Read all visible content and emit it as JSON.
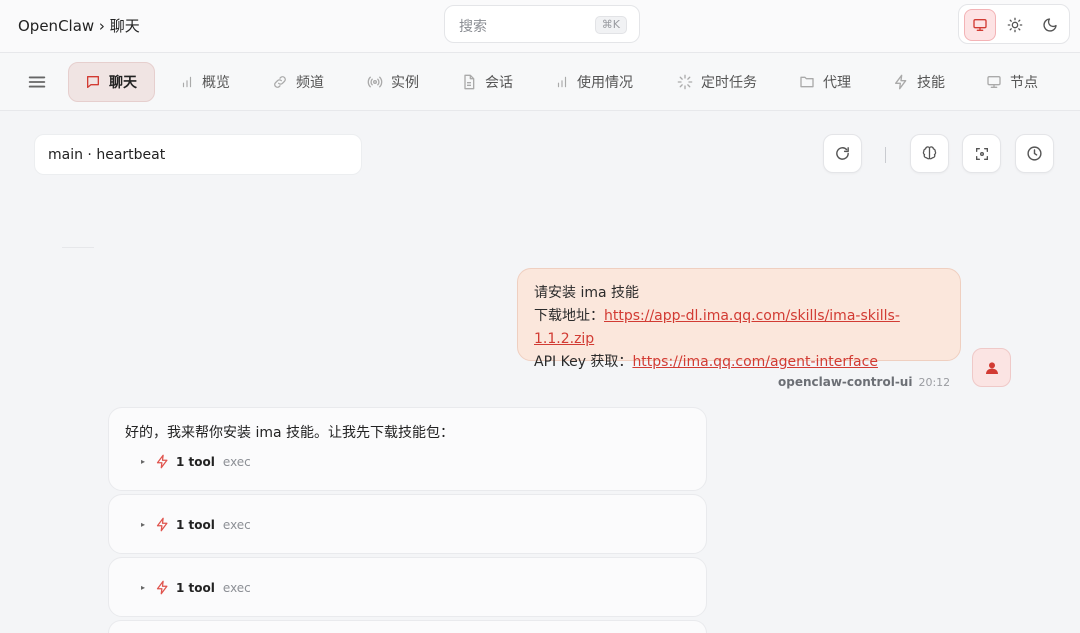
{
  "header": {
    "brand": "OpenClaw › 聊天",
    "search_placeholder": "搜索",
    "search_shortcut": "⌘K"
  },
  "theme": {
    "options": [
      "monitor-icon",
      "sun-icon",
      "moon-icon"
    ],
    "active": "monitor-icon"
  },
  "nav": {
    "tabs": [
      {
        "label": "聊天",
        "icon": "chat-icon",
        "active": true
      },
      {
        "label": "概览",
        "icon": "bar-chart-icon"
      },
      {
        "label": "频道",
        "icon": "link-icon"
      },
      {
        "label": "实例",
        "icon": "radio-icon"
      },
      {
        "label": "会话",
        "icon": "document-icon"
      },
      {
        "label": "使用情况",
        "icon": "bar-chart-icon"
      },
      {
        "label": "定时任务",
        "icon": "loader-icon"
      },
      {
        "label": "代理",
        "icon": "folder-icon"
      },
      {
        "label": "技能",
        "icon": "lightning-icon"
      },
      {
        "label": "节点",
        "icon": "monitor-icon"
      }
    ]
  },
  "session": {
    "selected": "main · heartbeat"
  },
  "toolbar": {
    "buttons": [
      "refresh-icon",
      "brain-icon",
      "focus-icon",
      "clock-icon"
    ]
  },
  "messages": {
    "user": {
      "line1": "请安装 ima 技能",
      "line2_label": "下载地址：",
      "line2_link": "https://app-dl.ima.qq.com/skills/ima-skills-1.1.2.zip",
      "line3_label": "API Key 获取：",
      "line3_link": "https://ima.qq.com/agent-interface",
      "sender": "openclaw-control-ui",
      "time": "20:12"
    },
    "assistant": [
      {
        "text": "好的，我来帮你安装 ima 技能。让我先下载技能包：",
        "tool_count": "1 tool",
        "tool_name": "exec"
      },
      {
        "text": "",
        "tool_count": "1 tool",
        "tool_name": "exec"
      },
      {
        "text": "",
        "tool_count": "1 tool",
        "tool_name": "exec"
      }
    ]
  },
  "colors": {
    "accent": "#d23b33",
    "user_bubble": "#fbe7dc",
    "active_tab": "#f0e4e3"
  }
}
